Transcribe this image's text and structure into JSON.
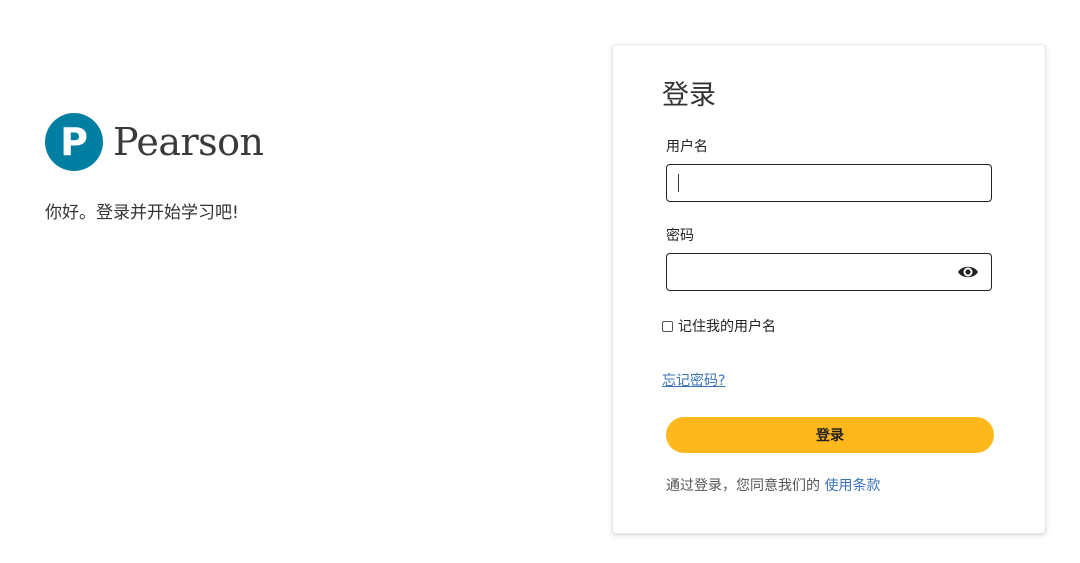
{
  "brand": {
    "name": "Pearson",
    "logo_letter": "P",
    "logo_color": "#007fa3",
    "greeting": "你好。登录并开始学习吧!"
  },
  "login": {
    "title": "登录",
    "username_label": "用户名",
    "username_value": "",
    "password_label": "密码",
    "password_value": "",
    "remember_label": "记住我的用户名",
    "remember_checked": false,
    "forgot_label": "忘记密码?",
    "submit_label": "登录",
    "terms_text": "通过登录，您同意我们的 ",
    "terms_link": "使用条款",
    "accent_color": "#ffb81c",
    "link_color": "#3a73b9"
  }
}
